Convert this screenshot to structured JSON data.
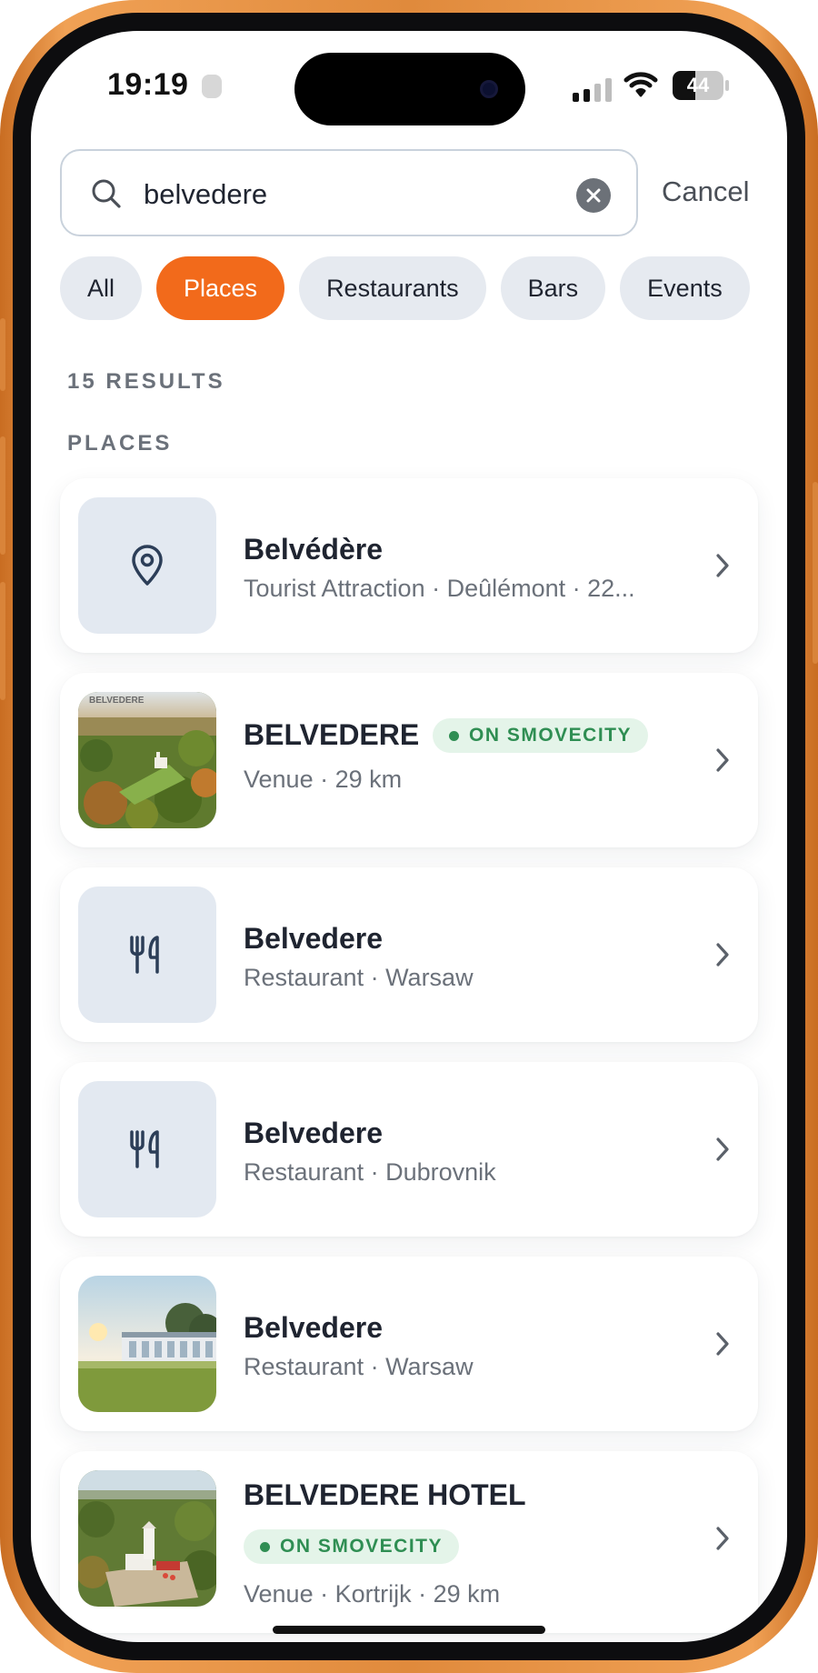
{
  "status_bar": {
    "time": "19:19",
    "battery": "44",
    "battery_level": 0.44
  },
  "search": {
    "value": "belvedere",
    "cancel_label": "Cancel"
  },
  "filters": {
    "all": "All",
    "places": "Places",
    "restaurants": "Restaurants",
    "bars": "Bars",
    "events": "Events",
    "active": "Places"
  },
  "results_count": "15 RESULTS",
  "section_title": "PLACES",
  "results": [
    {
      "title": "Belvédère",
      "subtitle": "Tourist Attraction · Deûlémont · 22...",
      "icon": "map-pin-icon"
    },
    {
      "title": "BELVEDERE",
      "badge": "ON SMOVECITY",
      "subtitle": "Venue · 29 km",
      "image": "aerial-forest-castle"
    },
    {
      "title": "Belvedere",
      "subtitle": "Restaurant · Warsaw",
      "icon": "fork-knife-icon"
    },
    {
      "title": "Belvedere",
      "subtitle": "Restaurant · Dubrovnik",
      "icon": "fork-knife-icon"
    },
    {
      "title": "Belvedere",
      "subtitle": "Restaurant · Warsaw",
      "image": "glass-pavilion-garden"
    },
    {
      "title": "BELVEDERE HOTEL",
      "badge": "ON SMOVECITY",
      "subtitle": "Venue · Kortrijk · 29 km",
      "image": "aerial-white-tower"
    }
  ],
  "colors": {
    "accent": "#f26a1b",
    "badge_bg": "#e4f4e9",
    "badge_text": "#2f8e53",
    "chip_bg": "#e6eaf0",
    "frame": "#e08a3c"
  }
}
